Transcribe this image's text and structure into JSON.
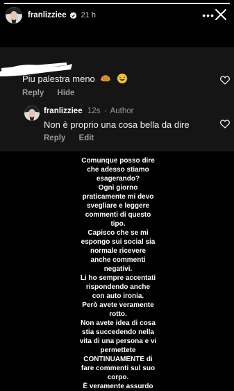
{
  "header": {
    "username": "franlizziee",
    "time": "21 h",
    "more_label": "•••",
    "progress": 1
  },
  "comment": {
    "text": "Piu palestra meno",
    "emojis": [
      "croissant-emoji",
      "laughing-tears-emoji"
    ],
    "reply_label": "Reply",
    "hide_label": "Hide"
  },
  "reply": {
    "username": "franlizziee",
    "time": "12s",
    "author_label": "Author",
    "text": "Non è proprio una cosa bella da dire",
    "reply_label": "Reply",
    "edit_label": "Edit"
  },
  "story_text": "Comunque posso dire\nche adesso stiamo\nesagerando?\nOgni giorno\npraticamente mi devo\nsvegliare e leggere\ncommenti di questo\ntipo.\nCapisco che se mi\nespongo sui social sia\nnormale ricevere\nanche commenti\nnegativi.\nLi ho sempre accentati\nrispondendo anche\ncon auto ironia.\nPerò avete veramente\nrotto.\nNon avete idea di cosa\nstia succedendo nella\nvita di una persona e vi\npermettete\nCONTINUAMENTE di\nfare commenti sul suo\ncorpo.\nÈ veramente assurdo",
  "colors": {
    "background": "#000000",
    "card": "#151515",
    "muted": "#9a9a9a"
  }
}
